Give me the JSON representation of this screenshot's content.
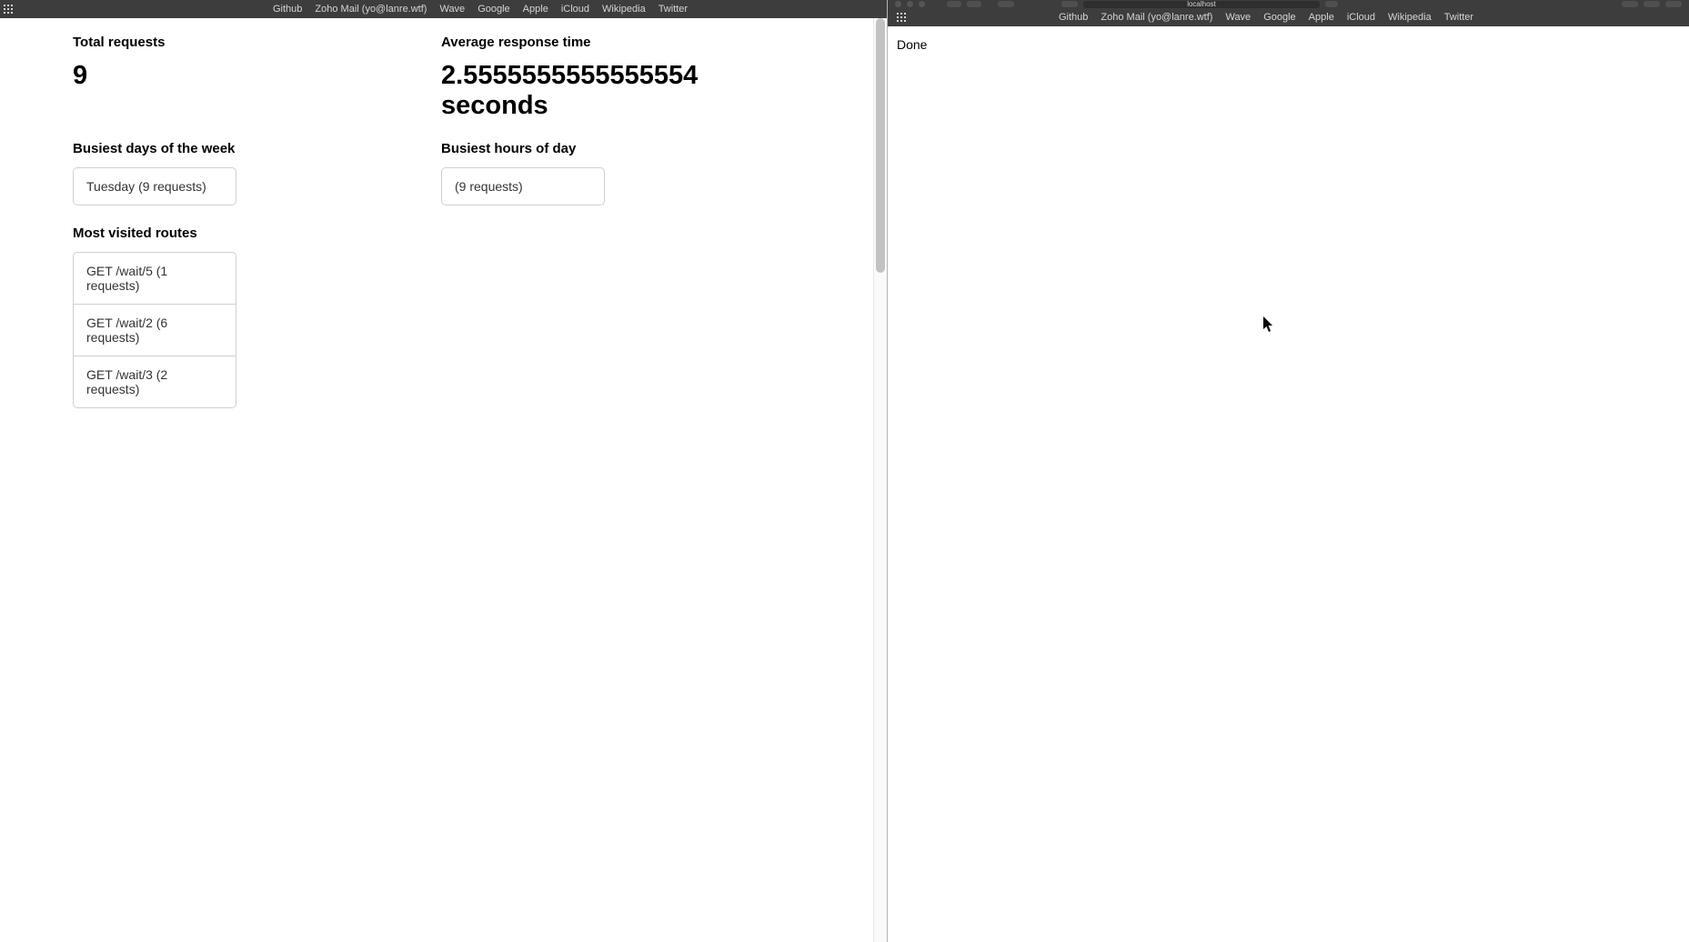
{
  "left_window": {
    "favorites": [
      "Github",
      "Zoho Mail (yo@lanre.wtf)",
      "Wave",
      "Google",
      "Apple",
      "iCloud",
      "Wikipedia",
      "Twitter"
    ],
    "stats": {
      "total_requests": {
        "label": "Total requests",
        "value": "9"
      },
      "avg_response": {
        "label": "Average response time",
        "value": "2.5555555555555554 seconds"
      },
      "busiest_days": {
        "label": "Busiest days of the week",
        "value": "Tuesday (9 requests)"
      },
      "busiest_hours": {
        "label": "Busiest hours of day",
        "value": "(9 requests)"
      },
      "routes": {
        "label": "Most visited routes",
        "items": [
          "GET /wait/5 (1 requests)",
          "GET /wait/2 (6 requests)",
          "GET /wait/3 (2 requests)"
        ]
      }
    }
  },
  "right_window": {
    "url": "localhost",
    "favorites": [
      "Github",
      "Zoho Mail (yo@lanre.wtf)",
      "Wave",
      "Google",
      "Apple",
      "iCloud",
      "Wikipedia",
      "Twitter"
    ],
    "body_text": "Done"
  }
}
